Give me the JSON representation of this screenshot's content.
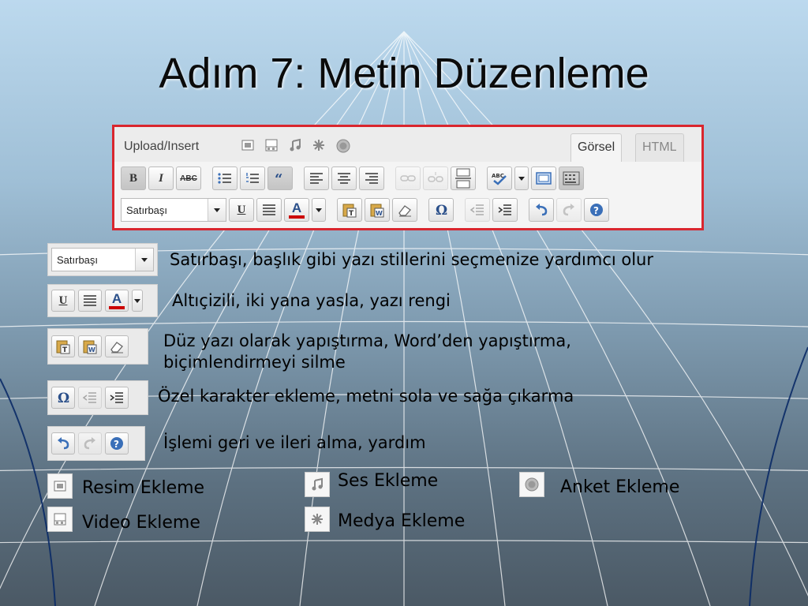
{
  "title": "Adım 7: Metin Düzenleme",
  "editor": {
    "upload_label": "Upload/Insert",
    "tabs": {
      "visual": "Görsel",
      "html": "HTML"
    },
    "media_icons": [
      "image-icon",
      "video-icon",
      "music-icon",
      "media-icon",
      "poll-icon"
    ],
    "row1": {
      "bold": "B",
      "italic": "I",
      "strikethrough": "ABC"
    },
    "format_select": "Satırbaşı",
    "underline": "U",
    "font_color": "A"
  },
  "legend": [
    {
      "strip_select": "Satırbaşı",
      "text": "Satırbaşı, başlık gibi yazı stillerini seçmenize yardımcı olur"
    },
    {
      "text": "Altıçizili, iki yana yasla, yazı rengi"
    },
    {
      "text": "Düz yazı olarak yapıştırma, Word’den yapıştırma, biçimlendirmeyi silme"
    },
    {
      "text": "Özel karakter ekleme, metni sola ve sağa çıkarma"
    },
    {
      "text": "İşlemi geri ve ileri alma, yardım"
    }
  ],
  "media_legend": {
    "image": "Resim Ekleme",
    "video": "Video Ekleme",
    "audio": "Ses Ekleme",
    "media": "Medya Ekleme",
    "poll": "Anket Ekleme"
  },
  "colors": {
    "highlight_border": "#d9262e",
    "font_color_bar": "#cc0000",
    "accent_blue": "#3a6fb8"
  }
}
